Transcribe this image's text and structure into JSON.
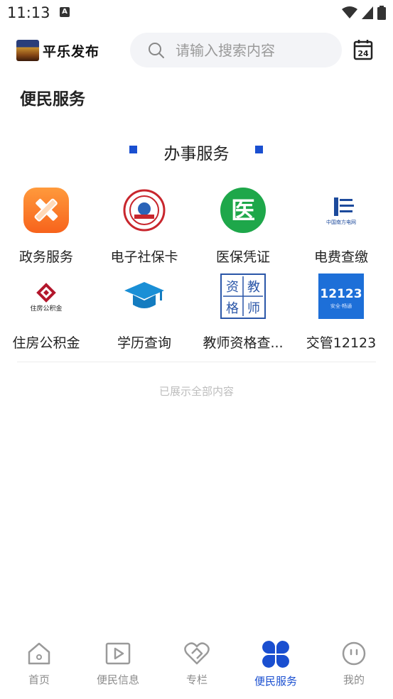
{
  "status": {
    "time": "11:13"
  },
  "header": {
    "brand": "平乐发布",
    "search_placeholder": "请输入搜索内容",
    "calendar_day": "24"
  },
  "page_title": "便民服务",
  "section": {
    "title": "办事服务",
    "accent": "#1a4fd0"
  },
  "services": [
    {
      "label": "政务服务",
      "icon": "pencil-ruler-icon"
    },
    {
      "label": "电子社保卡",
      "icon": "social-security-seal-icon"
    },
    {
      "label": "医保凭证",
      "icon": "medical-insurance-icon"
    },
    {
      "label": "电费查缴",
      "icon": "china-southern-grid-icon"
    },
    {
      "label": "住房公积金",
      "icon": "housing-fund-icon"
    },
    {
      "label": "学历查询",
      "icon": "graduation-cap-icon"
    },
    {
      "label": "教师资格查...",
      "icon": "teacher-cert-icon"
    },
    {
      "label": "交管12123",
      "icon": "traffic-12123-icon"
    }
  ],
  "icon_text": {
    "medical": "医",
    "grid_name": "中国南方电网",
    "fund_name": "住房公积金",
    "teacher": [
      "资",
      "教",
      "格",
      "师"
    ],
    "traffic_num": "12123",
    "traffic_sub": "安全·畅通"
  },
  "end_note": "已展示全部内容",
  "tabs": [
    {
      "label": "首页",
      "icon": "home-icon",
      "active": false
    },
    {
      "label": "便民信息",
      "icon": "video-play-icon",
      "active": false
    },
    {
      "label": "专栏",
      "icon": "heart-icon",
      "active": false
    },
    {
      "label": "便民服务",
      "icon": "four-petal-icon",
      "active": true
    },
    {
      "label": "我的",
      "icon": "smiley-icon",
      "active": false
    }
  ]
}
